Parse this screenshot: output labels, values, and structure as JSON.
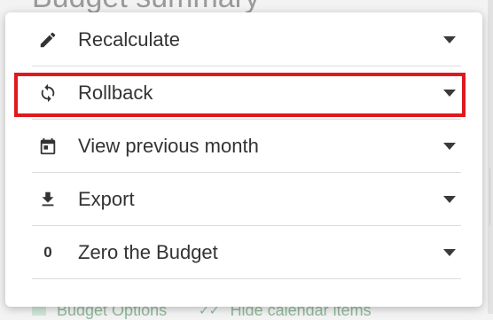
{
  "background": {
    "title": "Budget summary",
    "bottom_left": "Budget Options",
    "bottom_right": "Hide calendar items"
  },
  "menu": {
    "items": [
      {
        "label": "Recalculate",
        "icon": "pencil-icon"
      },
      {
        "label": "Rollback",
        "icon": "sync-icon",
        "highlighted": true
      },
      {
        "label": "View previous month",
        "icon": "calendar-icon"
      },
      {
        "label": "Export",
        "icon": "download-icon"
      },
      {
        "label": "Zero the Budget",
        "icon_text": "0",
        "icon": "zero-icon"
      }
    ]
  },
  "colors": {
    "highlight": "#e0191e",
    "text": "#333333",
    "accent_green": "#86b793"
  }
}
